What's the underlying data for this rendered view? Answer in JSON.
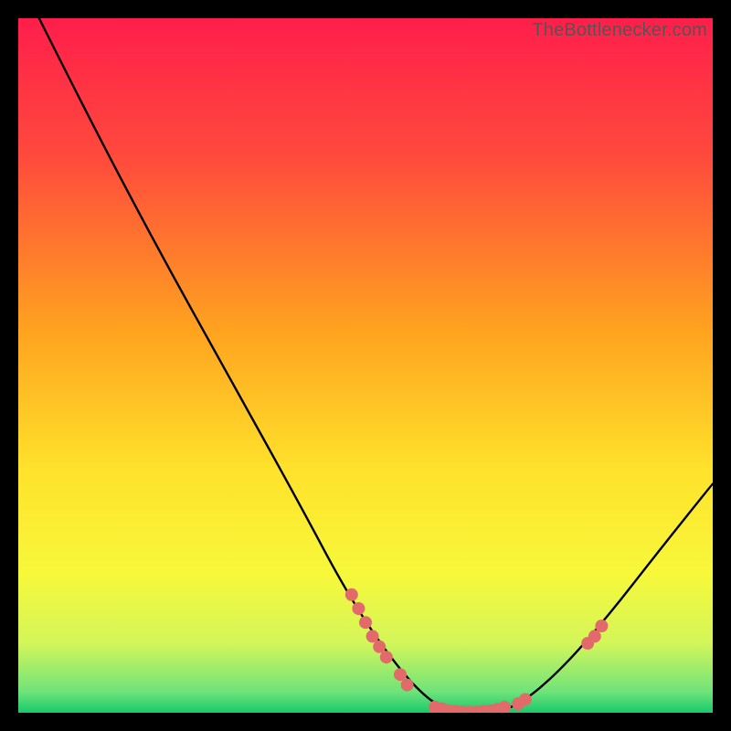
{
  "watermark": "TheBottlenecker.com",
  "chart_data": {
    "type": "line",
    "title": "",
    "xlabel": "",
    "ylabel": "",
    "xlim": [
      0,
      100
    ],
    "ylim": [
      0,
      100
    ],
    "gradient_stops": [
      {
        "offset": 0,
        "color": "#ff1e4b"
      },
      {
        "offset": 20,
        "color": "#ff4a3c"
      },
      {
        "offset": 45,
        "color": "#ffa31f"
      },
      {
        "offset": 65,
        "color": "#ffe22b"
      },
      {
        "offset": 80,
        "color": "#f7f83a"
      },
      {
        "offset": 90,
        "color": "#d3f65a"
      },
      {
        "offset": 97,
        "color": "#6fe37a"
      },
      {
        "offset": 100,
        "color": "#18c96b"
      }
    ],
    "curve": [
      {
        "x": 3,
        "y": 100
      },
      {
        "x": 10,
        "y": 86
      },
      {
        "x": 20,
        "y": 67
      },
      {
        "x": 30,
        "y": 49
      },
      {
        "x": 40,
        "y": 31
      },
      {
        "x": 48,
        "y": 16
      },
      {
        "x": 55,
        "y": 6
      },
      {
        "x": 60,
        "y": 1
      },
      {
        "x": 64,
        "y": 0
      },
      {
        "x": 68,
        "y": 0
      },
      {
        "x": 72,
        "y": 1
      },
      {
        "x": 78,
        "y": 6
      },
      {
        "x": 85,
        "y": 14
      },
      {
        "x": 92,
        "y": 23
      },
      {
        "x": 100,
        "y": 33
      }
    ],
    "markers_left": [
      {
        "x": 48,
        "y": 17
      },
      {
        "x": 49,
        "y": 15
      },
      {
        "x": 50,
        "y": 13
      },
      {
        "x": 51,
        "y": 11
      },
      {
        "x": 52,
        "y": 9.5
      },
      {
        "x": 53,
        "y": 8
      },
      {
        "x": 55,
        "y": 5.5
      },
      {
        "x": 56,
        "y": 4
      }
    ],
    "markers_bottom": [
      {
        "x": 60,
        "y": 0.8
      },
      {
        "x": 61,
        "y": 0.6
      },
      {
        "x": 62,
        "y": 0.3
      },
      {
        "x": 63,
        "y": 0.2
      },
      {
        "x": 64,
        "y": 0.1
      },
      {
        "x": 65,
        "y": 0.1
      },
      {
        "x": 66,
        "y": 0.1
      },
      {
        "x": 67,
        "y": 0.2
      },
      {
        "x": 68,
        "y": 0.3
      },
      {
        "x": 69,
        "y": 0.5
      },
      {
        "x": 70,
        "y": 0.8
      },
      {
        "x": 72,
        "y": 1.3
      },
      {
        "x": 73,
        "y": 1.9
      }
    ],
    "markers_right": [
      {
        "x": 82,
        "y": 10
      },
      {
        "x": 83,
        "y": 11
      },
      {
        "x": 84,
        "y": 12.5
      }
    ],
    "marker_color": "#e26a6a",
    "marker_radius": 7
  }
}
